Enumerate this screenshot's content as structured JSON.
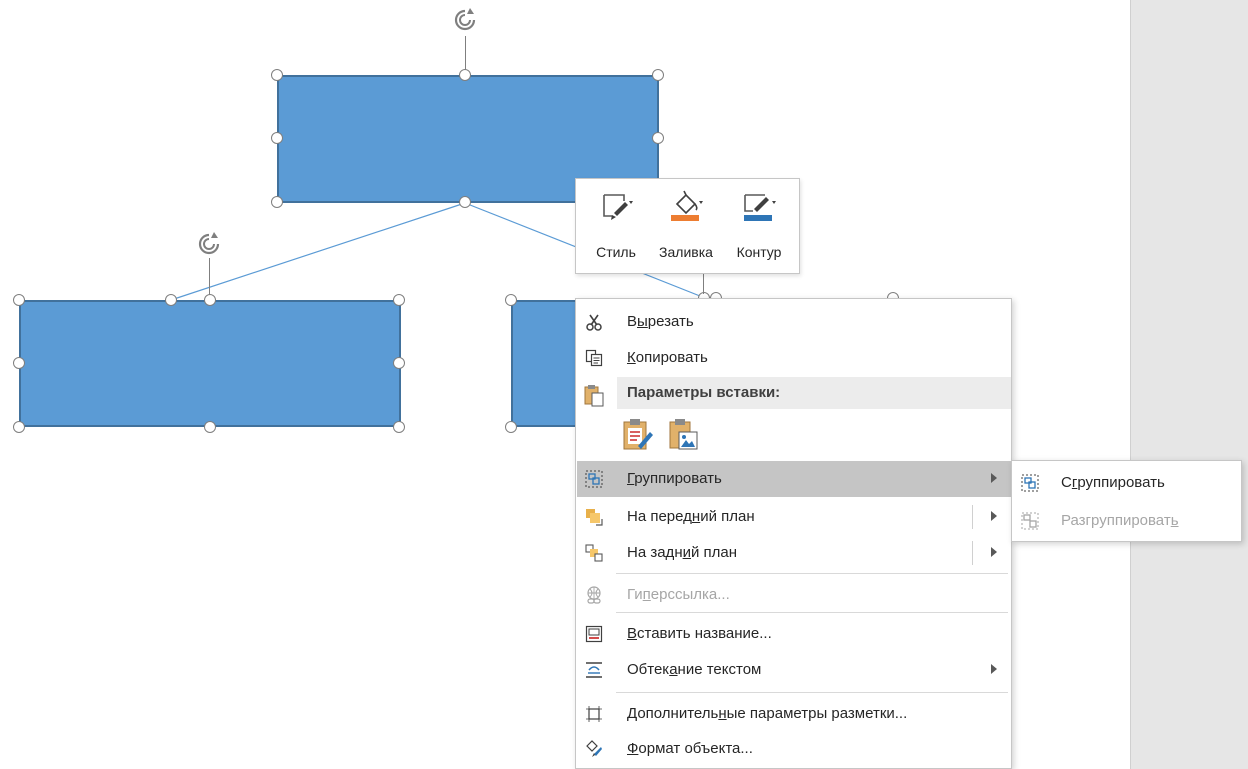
{
  "mini_toolbar": {
    "style_label": "Стиль",
    "fill_label": "Заливка",
    "outline_label": "Контур"
  },
  "context_menu": {
    "cut": {
      "pre": "В",
      "ul": "ы",
      "post": "резать"
    },
    "copy": {
      "pre": "",
      "ul": "К",
      "post": "опировать"
    },
    "paste_options": "Параметры вставки:",
    "group": {
      "pre": "",
      "ul": "Г",
      "post": "руппировать"
    },
    "bring_front": {
      "pre": "На перед",
      "ul": "н",
      "post": "ий план"
    },
    "send_back": {
      "pre": "На задн",
      "ul": "и",
      "post": "й план"
    },
    "hyperlink": {
      "pre": "Ги",
      "ul": "п",
      "post": "ерссылка..."
    },
    "insert_caption": {
      "pre": "",
      "ul": "В",
      "post": "ставить название..."
    },
    "wrap_text": {
      "pre": "Обтек",
      "ul": "а",
      "post": "ние текстом"
    },
    "more_layout": {
      "pre": "Дополнитель",
      "ul": "н",
      "post": "ые параметры разметки..."
    },
    "format_object": {
      "pre": "",
      "ul": "Ф",
      "post": "ормат объекта..."
    }
  },
  "submenu": {
    "group": {
      "pre": "С",
      "ul": "г",
      "post": "руппировать"
    },
    "ungroup": {
      "pre": "Разгруппироват",
      "ul": "ь",
      "post": ""
    }
  },
  "colors": {
    "shape_fill": "#5b9bd5",
    "shape_border": "#41719c",
    "fill_accent": "#ed7d31",
    "outline_accent": "#2e75b6",
    "selected_item": "#c5c5c5"
  }
}
